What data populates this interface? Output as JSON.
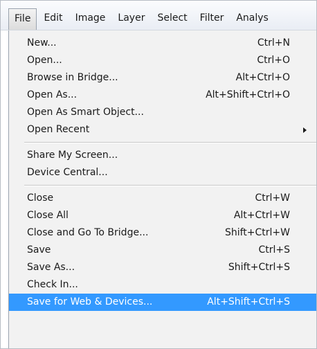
{
  "menubar": {
    "items": [
      "File",
      "Edit",
      "Image",
      "Layer",
      "Select",
      "Filter",
      "Analys"
    ]
  },
  "file_menu": {
    "group1": [
      {
        "label": "New...",
        "shortcut": "Ctrl+N"
      },
      {
        "label": "Open...",
        "shortcut": "Ctrl+O"
      },
      {
        "label": "Browse in Bridge...",
        "shortcut": "Alt+Ctrl+O"
      },
      {
        "label": "Open As...",
        "shortcut": "Alt+Shift+Ctrl+O"
      },
      {
        "label": "Open As Smart Object...",
        "shortcut": ""
      },
      {
        "label": "Open Recent",
        "shortcut": ""
      }
    ],
    "group2": [
      {
        "label": "Share My Screen...",
        "shortcut": ""
      },
      {
        "label": "Device Central...",
        "shortcut": ""
      }
    ],
    "group3": [
      {
        "label": "Close",
        "shortcut": "Ctrl+W"
      },
      {
        "label": "Close All",
        "shortcut": "Alt+Ctrl+W"
      },
      {
        "label": "Close and Go To Bridge...",
        "shortcut": "Shift+Ctrl+W"
      },
      {
        "label": "Save",
        "shortcut": "Ctrl+S"
      },
      {
        "label": "Save As...",
        "shortcut": "Shift+Ctrl+S"
      },
      {
        "label": "Check In...",
        "shortcut": ""
      },
      {
        "label": "Save for Web & Devices...",
        "shortcut": "Alt+Shift+Ctrl+S"
      }
    ]
  },
  "colors": {
    "highlight": "#3399ff",
    "menu_background": "#f2f2f2"
  },
  "icons": {
    "submenu_arrow": "chevron-right-icon"
  }
}
